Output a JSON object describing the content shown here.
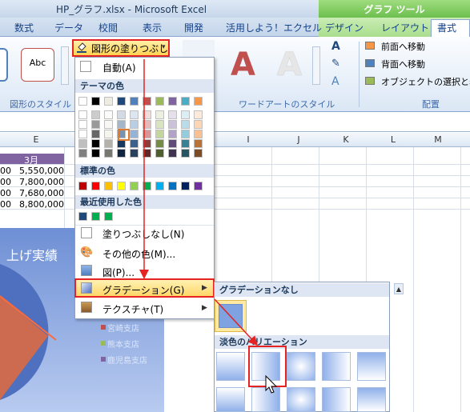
{
  "window": {
    "title": "HP_グラフ.xlsx - Microsoft Excel",
    "context_title": "グラフ ツール"
  },
  "tabs": [
    "数式",
    "データ",
    "校閲",
    "表示",
    "開発",
    "活用しよう！エクセル",
    "デザイン",
    "レイアウト",
    "書式"
  ],
  "ribbon": {
    "shape_fill_label": "図形の塗りつぶし",
    "abc_label": "Abc",
    "groups": {
      "shape_styles": "図形のスタイル",
      "wordart_styles": "ワードアートのスタイル",
      "arrange": "配置"
    },
    "arrange": {
      "bring_forward": "前面へ移動",
      "send_backward": "背面へ移動",
      "selection_pane": "オブジェクトの選択と表示"
    }
  },
  "columns": [
    "E",
    "I",
    "J",
    "K",
    "L",
    "M"
  ],
  "sheet": {
    "header_cell": "3月",
    "values": [
      "5,550,000",
      "7,800,000",
      "7,680,000",
      "8,800,000"
    ],
    "row_prefix": [
      "00",
      "00",
      "00",
      "00"
    ],
    "chart_title": "上げ実績",
    "legend": [
      "宮崎支店",
      "熊本支店",
      "鹿児島支店"
    ]
  },
  "color_menu": {
    "auto": "自動(A)",
    "theme_colors": "テーマの色",
    "standard_colors": "標準の色",
    "recent_colors": "最近使用した色",
    "no_fill": "塗りつぶしなし(N)",
    "more_colors": "その他の色(M)...",
    "picture": "図(P)...",
    "gradient": "グラデーション(G)",
    "texture": "テクスチャ(T)"
  },
  "gradient_menu": {
    "no_gradient": "グラデーションなし",
    "light_variations": "淡色のバリエーション"
  },
  "colors": {
    "theme_row": [
      "#ffffff",
      "#000000",
      "#eeece1",
      "#1f497d",
      "#4f81bd",
      "#c0504d",
      "#9bbb59",
      "#8064a2",
      "#4bacc6",
      "#f79646"
    ],
    "standard": [
      "#c00000",
      "#ff0000",
      "#ffc000",
      "#ffff00",
      "#92d050",
      "#00b050",
      "#00b0f0",
      "#0070c0",
      "#002060",
      "#7030a0"
    ],
    "recent": [
      "#1f497d",
      "#00b050",
      "#00b050"
    ],
    "accent_red": "#e52323"
  }
}
